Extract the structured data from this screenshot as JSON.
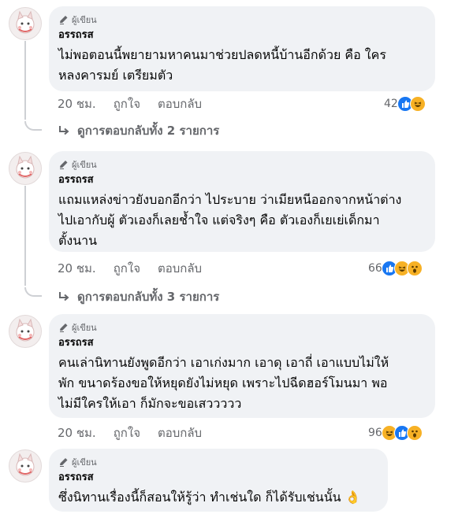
{
  "comments": [
    {
      "badge": "ผู้เขียน",
      "author": "อรรถรส",
      "text": "ไม่พอตอนนี้พยายามหาคนมาช่วยปลดหนี้บ้านอีกด้วย คือ ใคร\nหลงคารมย์ เตรียมตัว",
      "time": "20 ชม.",
      "like_label": "ถูกใจ",
      "reply_label": "ตอบกลับ",
      "reaction_count": "42",
      "reactions": [
        "like-icon",
        "haha-icon"
      ],
      "view_replies": "ดูการตอบกลับทั้ง 2 รายการ"
    },
    {
      "badge": "ผู้เขียน",
      "author": "อรรถรส",
      "text": "แถมแหล่งข่าวยังบอกอีกว่า ไประบาย ว่าเมียหนีออกจากหน้าต่าง\nไปเอากับผู้ ตัวเองก็เลยช้ำใจ แต่จริงๆ คือ ตัวเองก็เยเย่เด็กมา\nตั้งนาน",
      "time": "20 ชม.",
      "like_label": "ถูกใจ",
      "reply_label": "ตอบกลับ",
      "reaction_count": "66",
      "reactions": [
        "like-icon",
        "haha-icon",
        "wow-icon"
      ],
      "view_replies": "ดูการตอบกลับทั้ง 3 รายการ"
    },
    {
      "badge": "ผู้เขียน",
      "author": "อรรถรส",
      "text": "คนเล่านิทานยังพูดอีกว่า เอาเก่งมาก เอาดุ เอาถี่ เอาแบบไม่ให้\nพัก ขนาดร้องขอให้หยุดยังไม่หยุด เพราะไปฉีดฮอร์โมนมา พอ\nไม่มีใครให้เอา ก็มักจะขอเสววววว",
      "time": "20 ชม.",
      "like_label": "ถูกใจ",
      "reply_label": "ตอบกลับ",
      "reaction_count": "96",
      "reactions": [
        "haha-icon",
        "like-icon",
        "wow-icon"
      ]
    },
    {
      "badge": "ผู้เขียน",
      "author": "อรรถรส",
      "text": "ซึ่งนิทานเรื่องนี้ก็สอนให้รู้ว่า ทำเช่นใด ก็ได้รับเช่นนั้น 👌"
    }
  ],
  "colors": {
    "bubble": "#f0f2f5",
    "meta_text": "#65676b",
    "like_blue": "#1877f2",
    "haha_yellow": "#f7b125"
  }
}
